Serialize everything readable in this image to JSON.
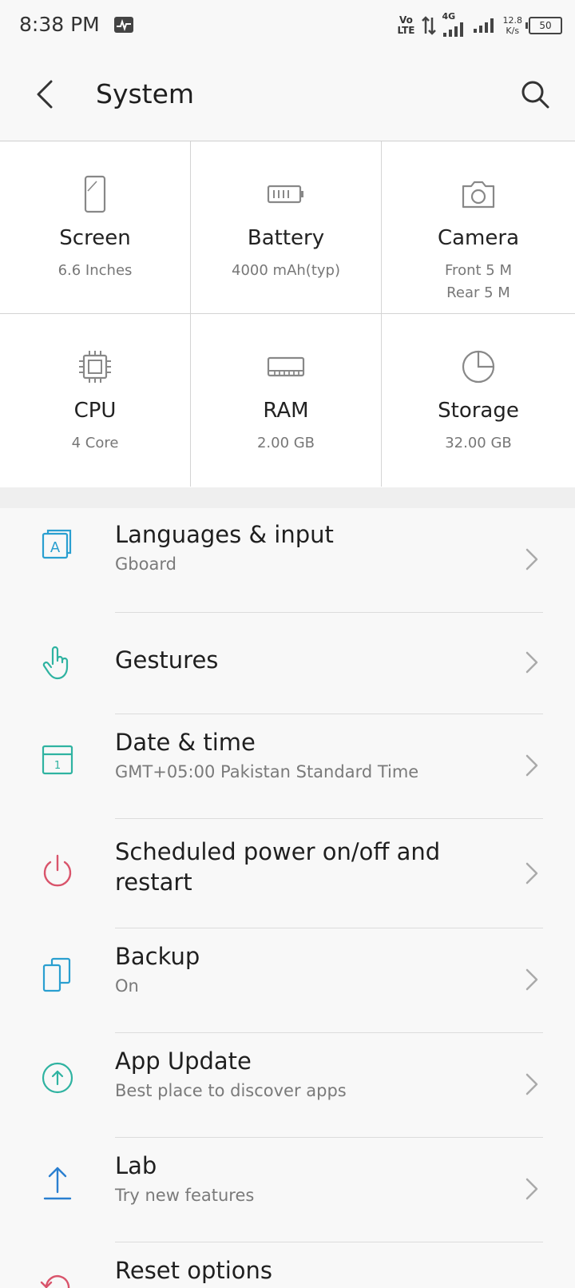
{
  "status_bar": {
    "time": "8:38 PM",
    "volte_top": "Vo",
    "volte_bottom": "LTE",
    "network": "4G",
    "speed_value": "12.8",
    "speed_unit": "K/s",
    "battery": "50"
  },
  "app_bar": {
    "title": "System"
  },
  "specs": [
    {
      "label": "Screen",
      "value": "6.6 Inches",
      "icon": "phone-screen-icon"
    },
    {
      "label": "Battery",
      "value": "4000 mAh(typ)",
      "icon": "battery-icon"
    },
    {
      "label": "Camera",
      "value": "Front 5 M",
      "value2": "Rear 5 M",
      "icon": "camera-icon"
    },
    {
      "label": "CPU",
      "value": "4 Core",
      "icon": "cpu-chip-icon"
    },
    {
      "label": "RAM",
      "value": "2.00 GB",
      "icon": "ram-icon"
    },
    {
      "label": "Storage",
      "value": "32.00 GB",
      "icon": "pie-chart-icon"
    }
  ],
  "settings": [
    {
      "title": "Languages & input",
      "subtitle": "Gboard",
      "icon": "language-icon",
      "color": "#2a9fd0"
    },
    {
      "title": "Gestures",
      "icon": "gesture-hand-icon",
      "color": "#2fb3a1"
    },
    {
      "title": "Date & time",
      "subtitle": "GMT+05:00 Pakistan Standard Time",
      "icon": "calendar-icon",
      "color": "#2fb3a1"
    },
    {
      "title": "Scheduled power on/off and",
      "title2": "restart",
      "icon": "power-icon",
      "color": "#d9546b"
    },
    {
      "title": "Backup",
      "subtitle": "On",
      "icon": "backup-icon",
      "color": "#2a9fd0"
    },
    {
      "title": "App Update",
      "subtitle": "Best place to discover apps",
      "icon": "app-update-icon",
      "color": "#2fb3a1"
    },
    {
      "title": "Lab",
      "subtitle": "Try new features",
      "icon": "upload-arrow-icon",
      "color": "#2a7fd0"
    },
    {
      "title": "Reset options",
      "icon": "reset-icon",
      "color": "#d9546b"
    }
  ]
}
